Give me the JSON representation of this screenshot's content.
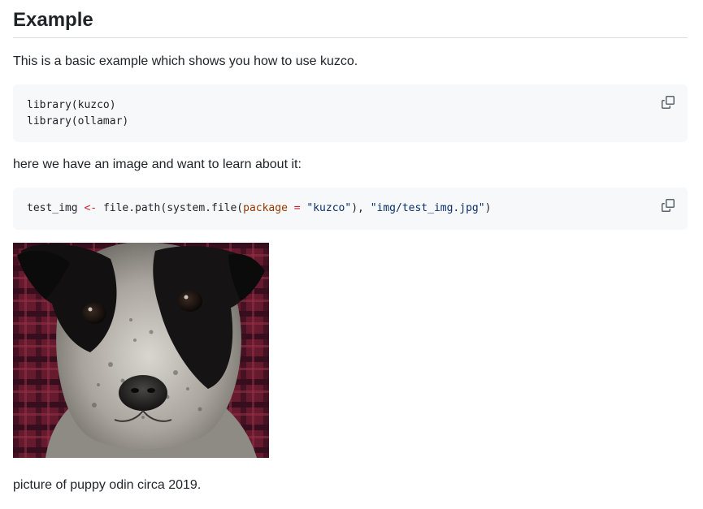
{
  "heading": "Example",
  "intro": "This is a basic example which shows you how to use kuzco.",
  "code1": {
    "lines": [
      "library(kuzco)",
      "library(ollamar)"
    ]
  },
  "middle_text": "here we have an image and want to learn about it:",
  "code2": {
    "var": "test_img",
    "assign": "<-",
    "fn_open": "file.path(system.file(",
    "arg": "package",
    "eq": "=",
    "str1": "\"kuzco\"",
    "mid": "), ",
    "str2": "\"img/test_img.jpg\"",
    "close": ")"
  },
  "copy_icon": "copy-icon",
  "image": {
    "subject": "puppy"
  },
  "caption": "picture of puppy odin circa 2019.",
  "colors": {
    "text": "#1f2328",
    "code_bg": "#f6f8fa",
    "operator": "#cf222e",
    "argument": "#953800",
    "string": "#0a3069",
    "icon": "#59636e"
  }
}
